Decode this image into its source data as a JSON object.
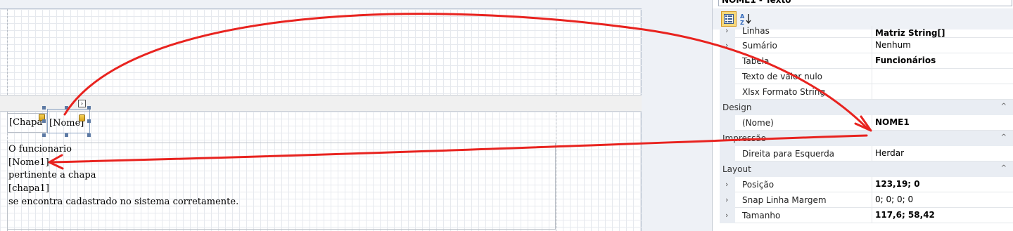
{
  "designer": {
    "header_fields": {
      "chapa": "[Chapa",
      "nome": "[Nome]"
    },
    "smart_tag": "›",
    "text_lines": [
      "O funcionario",
      "[Nome1]",
      "pertinente a chapa",
      "[chapa1]",
      "se encontra cadastrado no sistema corretamente."
    ]
  },
  "properties": {
    "title": "NOME1 - Texto",
    "toolbar": {
      "categorized_icon": "categorized-icon",
      "alphabetical_icon": "sort-az-icon"
    },
    "rows": {
      "linhas": {
        "name": "Linhas",
        "value": "Matriz String[]"
      },
      "sumario": {
        "name": "Sumário",
        "value": "Nenhum"
      },
      "tabela": {
        "name": "Tabela",
        "value": "Funcionários"
      },
      "texto_nulo": {
        "name": "Texto de valor nulo",
        "value": ""
      },
      "xlsx": {
        "name": "Xlsx Formato String",
        "value": ""
      },
      "nome": {
        "name": "(Nome)",
        "value": "NOME1"
      },
      "direita": {
        "name": "Direita para Esquerda",
        "value": "Herdar"
      },
      "posicao": {
        "name": "Posição",
        "value": "123,19; 0"
      },
      "snap": {
        "name": "Snap Linha Margem",
        "value": "0; 0; 0; 0"
      },
      "tamanho": {
        "name": "Tamanho",
        "value": "117,6; 58,42"
      }
    },
    "categories": {
      "design": "Design",
      "impressao": "Impressão",
      "layout": "Layout"
    }
  },
  "colors": {
    "arrow": "#e8231f",
    "selection_handle": "#5d7aa4"
  }
}
